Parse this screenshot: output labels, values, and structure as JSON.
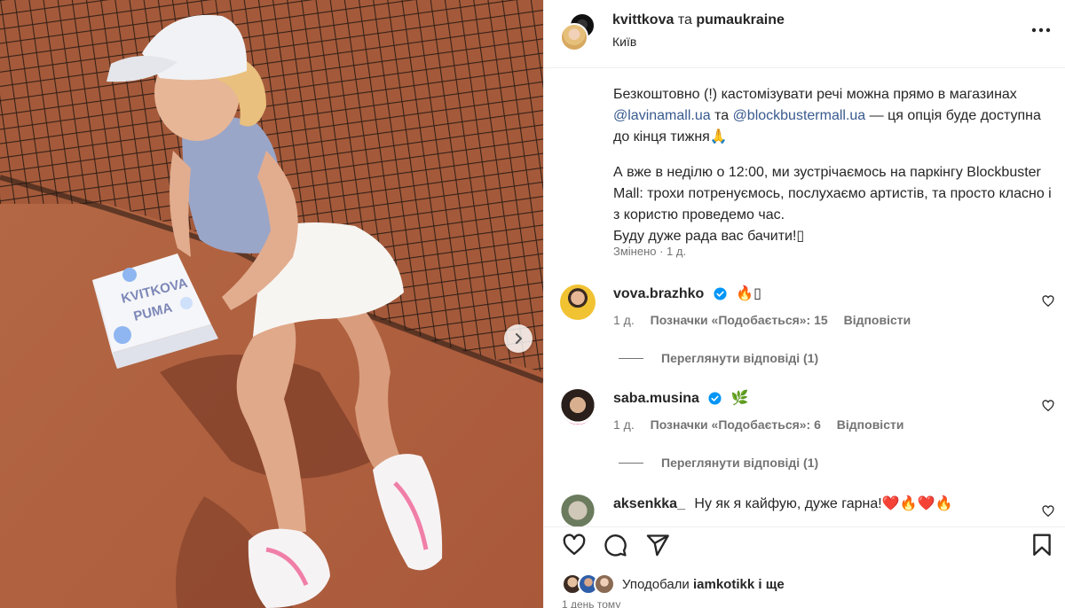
{
  "post": {
    "header": {
      "author": "kvittkova",
      "connector": "та",
      "collaborator": "pumaukraine",
      "location": "Київ",
      "more_icon": "more-horizontal-icon"
    },
    "image": {
      "box_text_line1": "KVITKOVA",
      "box_text_line2": "PUMA",
      "next_icon": "chevron-right-icon"
    },
    "caption": {
      "p1_text1": "Безкоштовно (!) кастомізувати речі можна прямо в магазинах ",
      "mention1": "@lavinamall.ua",
      "p1_text2": " та ",
      "mention2": "@blockbustermall.ua",
      "p1_text3": " — ця опція буде доступна до кінця тижня🙏",
      "p2_line1": "А вже в неділю о 12:00, ми зустрічаємось на паркінгу Blockbuster Mall: трохи потренуємось, послухаємо артистів, та просто класно і з користю проведемо час.",
      "p2_line2": "Буду дуже рада вас бачити!▯",
      "edited": "Змінено · 1 д."
    },
    "comments": [
      {
        "user": "vova.brazhko",
        "verified": true,
        "text": "🔥▯",
        "time": "1 д.",
        "likes": "Позначки «Подобається»: 15",
        "reply": "Відповісти",
        "view_replies": "Переглянути відповіді (1)"
      },
      {
        "user": "saba.musina",
        "verified": true,
        "text": "🌿",
        "time": "1 д.",
        "likes": "Позначки «Подобається»: 6",
        "reply": "Відповісти",
        "view_replies": "Переглянути відповіді (1)"
      },
      {
        "user": "aksenkka_",
        "verified": false,
        "text": "Ну як я кайфую, дуже гарна!❤️🔥❤️🔥"
      }
    ],
    "actions": {
      "like_icon": "heart-icon",
      "comment_icon": "comment-icon",
      "share_icon": "send-icon",
      "save_icon": "bookmark-icon"
    },
    "likes": {
      "prefix": "Уподобали",
      "user": "iamkotikk",
      "suffix": "і ще"
    },
    "time_ago": "1 день тому"
  },
  "colors": {
    "mention": "#385a8f",
    "verified": "#0095f6",
    "muted": "#737373",
    "clay": "#b3643f"
  }
}
